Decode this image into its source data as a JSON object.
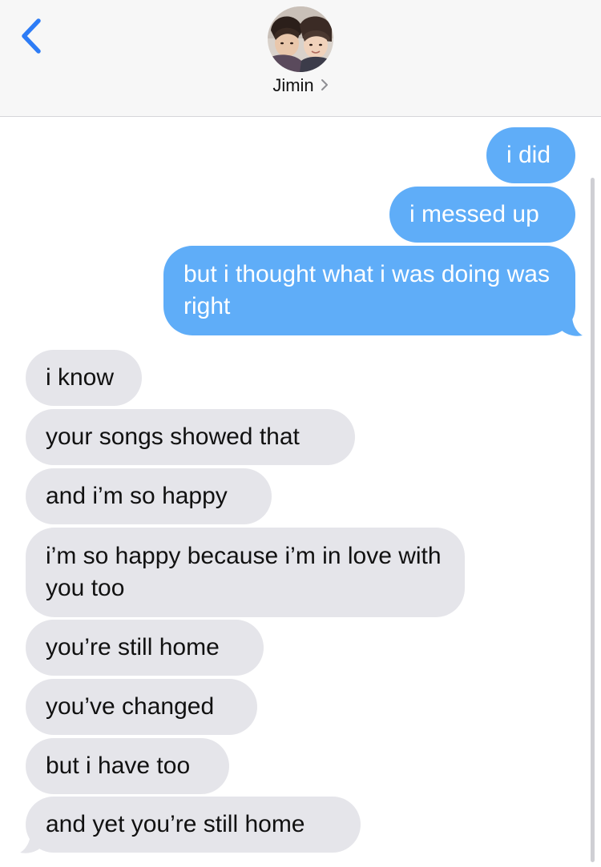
{
  "header": {
    "contact_name": "Jimin",
    "accent_color": "#2d7cf6"
  },
  "colors": {
    "sent_bubble": "#5fadf8",
    "received_bubble": "#e5e5ea"
  },
  "messages": [
    {
      "direction": "sent",
      "text": "i did"
    },
    {
      "direction": "sent",
      "text": "i messed up"
    },
    {
      "direction": "sent",
      "text": "but i thought what i was doing was right"
    },
    {
      "direction": "received",
      "text": "i know"
    },
    {
      "direction": "received",
      "text": "your songs showed that"
    },
    {
      "direction": "received",
      "text": "and i’m so happy"
    },
    {
      "direction": "received",
      "text": "i’m so happy because i’m in love with you too"
    },
    {
      "direction": "received",
      "text": "you’re still home"
    },
    {
      "direction": "received",
      "text": "you’ve changed"
    },
    {
      "direction": "received",
      "text": "but i have too"
    },
    {
      "direction": "received",
      "text": "and yet you’re still home"
    }
  ]
}
